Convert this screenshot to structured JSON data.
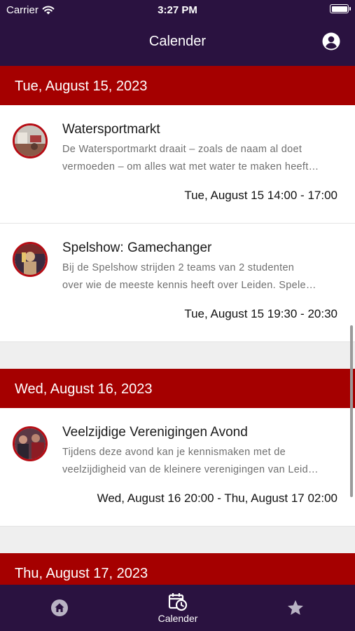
{
  "status": {
    "carrier": "Carrier",
    "time": "3:27 PM"
  },
  "header": {
    "title": "Calender"
  },
  "days": [
    {
      "label": "Tue, August 15, 2023",
      "events": [
        {
          "title": "Watersportmarkt",
          "desc1": "De Watersportmarkt draait – zoals de naam al doet",
          "desc2": "vermoeden – om alles wat met water te maken heeft…",
          "time": "Tue, August 15 14:00 - 17:00"
        },
        {
          "title": "Spelshow: Gamechanger",
          "desc1": "Bij de Spelshow strijden 2 teams van 2 studenten",
          "desc2": "over wie de meeste kennis heeft over Leiden. Spele…",
          "time": "Tue, August 15 19:30 - 20:30"
        }
      ]
    },
    {
      "label": "Wed, August 16, 2023",
      "events": [
        {
          "title": "Veelzijdige Verenigingen Avond",
          "desc1": "Tijdens deze avond kan je kennismaken met de",
          "desc2": "veelzijdigheid van de kleinere verenigingen van Leid…",
          "time": "Wed, August 16 20:00 - Thu, August 17 02:00"
        }
      ]
    },
    {
      "label": "Thu, August 17, 2023"
    }
  ],
  "tabs": {
    "calendar_label": "Calender"
  },
  "icons": [
    "wifi-icon",
    "battery-icon",
    "profile-icon",
    "home-icon",
    "calendar-clock-icon",
    "star-icon"
  ],
  "colors": {
    "bar": "#2a1240",
    "day_header": "#a50000",
    "avatar_ring": "#b60c14",
    "background": "#efefef"
  }
}
